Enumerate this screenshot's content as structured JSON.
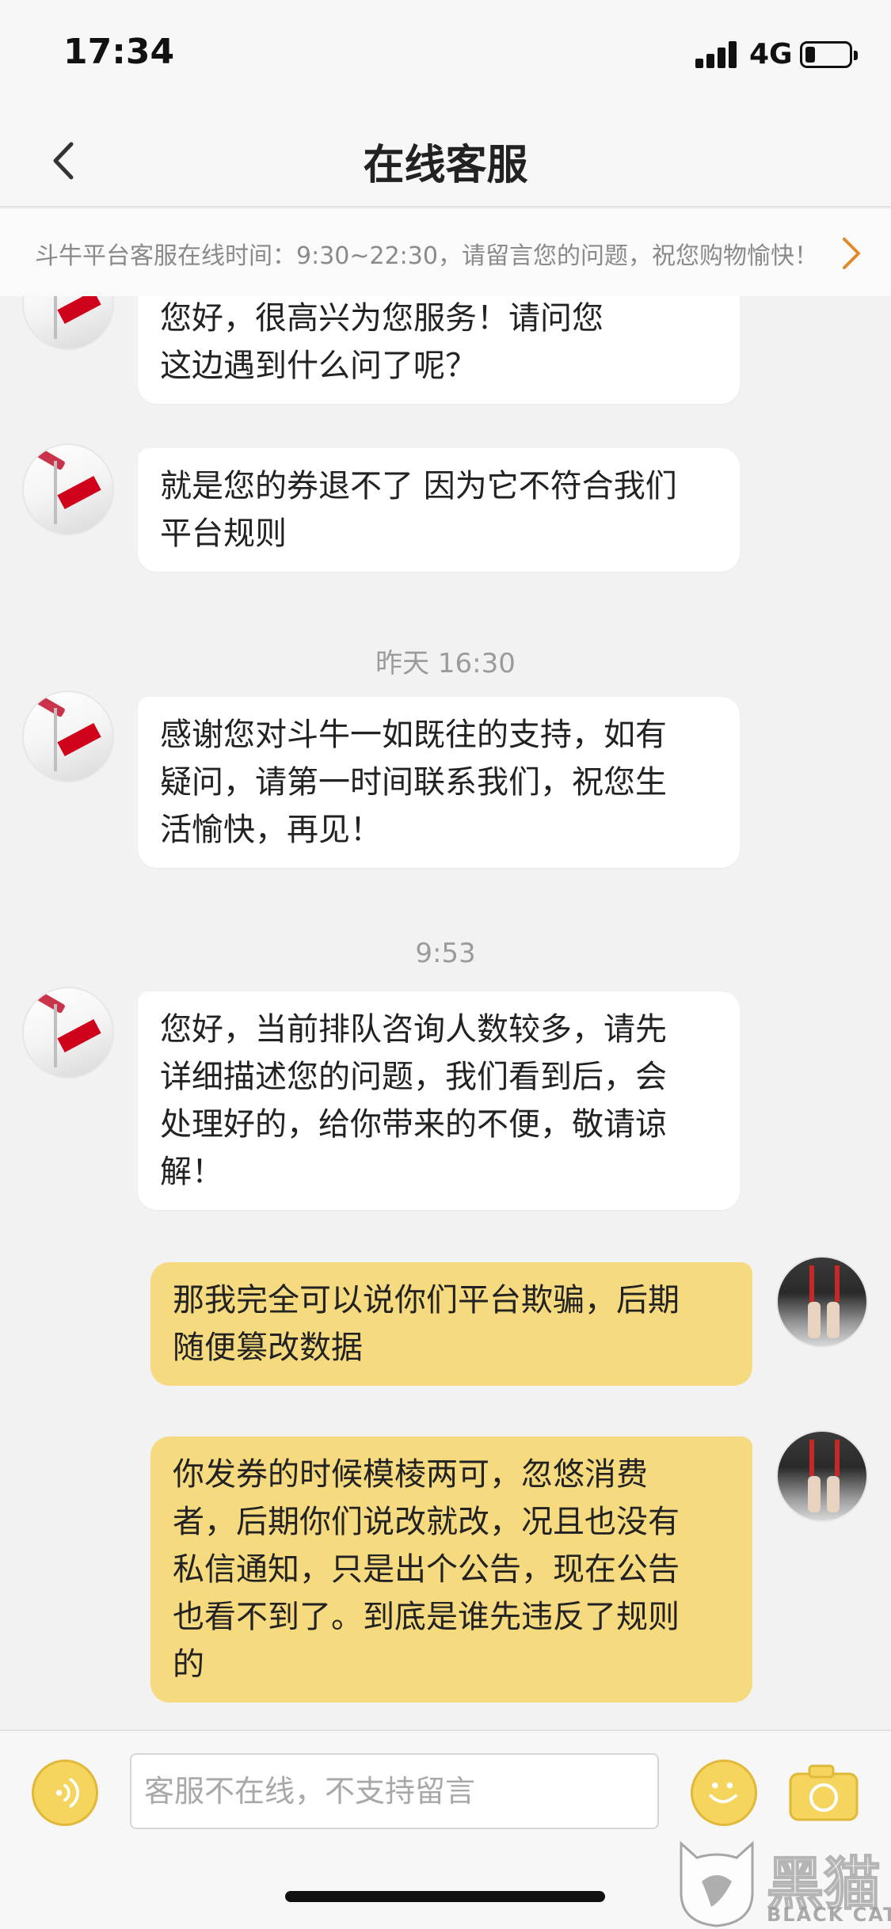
{
  "status_bar": {
    "time": "17:34",
    "network": "4G",
    "icons": [
      "signal-icon",
      "battery-icon"
    ]
  },
  "nav": {
    "title": "在线客服",
    "back_icon": "chevron-left-icon"
  },
  "notice": {
    "text": "斗牛平台客服在线时间：9:30~22:30，请留言您的问题，祝您购物愉快！",
    "arrow_icon": "chevron-right-icon",
    "arrow_color": "#e08a2a"
  },
  "messages": [
    {
      "side": "left",
      "text": "您好，很高兴为您服务！请问您\n这边遇到什么问了呢？"
    },
    {
      "side": "left",
      "text": "就是您的券退不了 因为它不符合我们\n平台规则"
    },
    {
      "timestamp": "昨天 16:30"
    },
    {
      "side": "left",
      "text": "感谢您对斗牛一如既往的支持，如有\n疑问，请第一时间联系我们，祝您生\n活愉快，再见！"
    },
    {
      "timestamp": "9:53"
    },
    {
      "side": "left",
      "text": "您好，当前排队咨询人数较多，请先\n详细描述您的问题，我们看到后，会\n处理好的，给你带来的不便，敬请谅\n解！"
    },
    {
      "side": "right",
      "text": "那我完全可以说你们平台欺骗，后期\n随便篡改数据"
    },
    {
      "side": "right",
      "text": "你发券的时候模棱两可，忽悠消费\n者，后期你们说改就改，况且也没有\n私信通知，只是出个公告，现在公告\n也看不到了。到底是谁先违反了规则\n的"
    }
  ],
  "input_bar": {
    "placeholder": "客服不在线，不支持留言",
    "value": "",
    "icons": [
      "voice-icon",
      "emoji-icon",
      "camera-icon"
    ],
    "accent": "#f6d55f"
  },
  "colors": {
    "incoming_bubble": "#ffffff",
    "outgoing_bubble": "#f6da7f",
    "background": "#f2f2f2"
  },
  "watermark": {
    "text": "黑猫",
    "subtext": "BLACK CAT"
  }
}
